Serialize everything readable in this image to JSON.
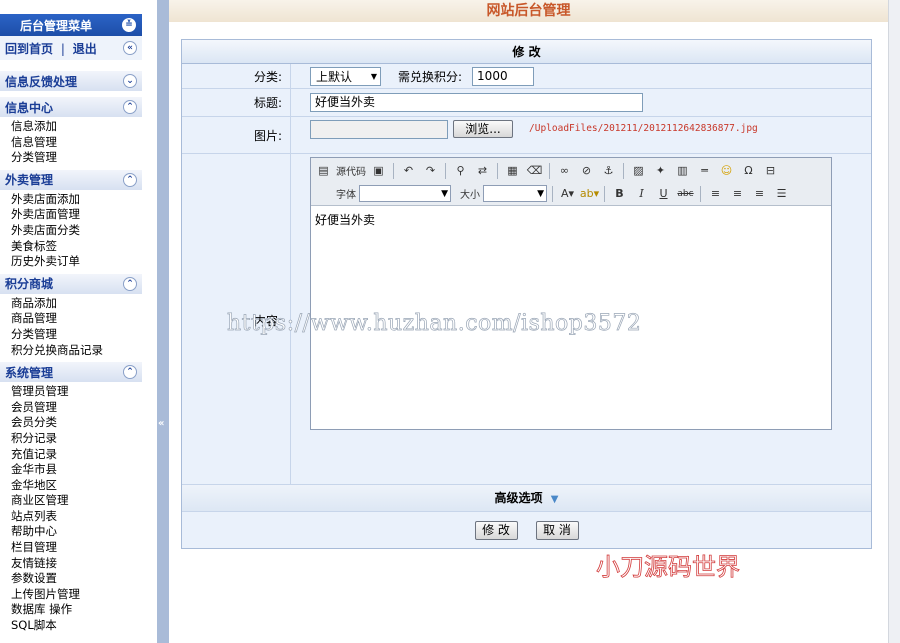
{
  "sidebar": {
    "title": "后台管理菜单",
    "home_link": "回到首页",
    "separator": "|",
    "logout_link": "退出",
    "sections": [
      {
        "title": "信息反馈处理",
        "items": []
      },
      {
        "title": "信息中心",
        "items": [
          "信息添加",
          "信息管理",
          "分类管理"
        ]
      },
      {
        "title": "外卖管理",
        "items": [
          "外卖店面添加",
          "外卖店面管理",
          "外卖店面分类",
          "美食标签",
          "历史外卖订单"
        ]
      },
      {
        "title": "积分商城",
        "items": [
          "商品添加",
          "商品管理",
          "分类管理",
          "积分兑换商品记录"
        ]
      },
      {
        "title": "系统管理",
        "items": [
          "管理员管理",
          "会员管理",
          "会员分类",
          "积分记录",
          "充值记录",
          "金华市县",
          "金华地区",
          "商业区管理",
          "站点列表",
          "帮助中心",
          "栏目管理",
          "友情链接",
          "参数设置",
          "上传图片管理",
          "数据库 操作",
          "SQL脚本"
        ]
      }
    ]
  },
  "header": {
    "title": "网站后台管理"
  },
  "form": {
    "heading": "修 改",
    "category_label": "分类:",
    "category_value": "上默认",
    "points_label": "需兑换积分:",
    "points_value": "1000",
    "title_label": "标题:",
    "title_value": "好便当外卖",
    "image_label": "图片:",
    "browse_button": "浏览...",
    "image_path": "/UploadFiles/201211/2012112642836877.jpg",
    "content_label": "内容:",
    "editor": {
      "source_label": "源代码",
      "font_label": "字体",
      "size_label": "大小",
      "content": "好便当外卖"
    },
    "advanced_label": "高级选项",
    "submit_button": "修 改",
    "cancel_button": "取 消"
  },
  "watermark": "https://www.huzhan.com/ishop3572",
  "brand_mark": "小刀源码世界",
  "colors": {
    "sidebar_title": "#1d4ea8",
    "header_text": "#c8582a",
    "image_path": "#c8382a"
  }
}
